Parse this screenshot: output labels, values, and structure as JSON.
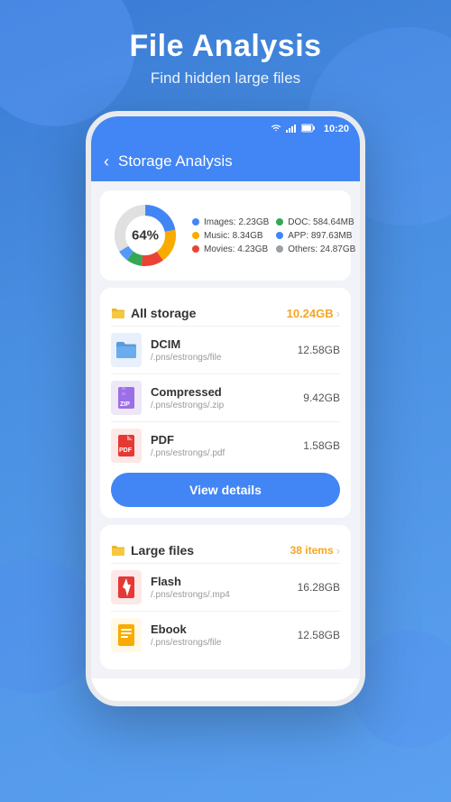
{
  "header": {
    "title": "File Analysis",
    "subtitle": "Find hidden large files"
  },
  "status_bar": {
    "time": "10:20"
  },
  "top_bar": {
    "title": "Storage Analysis",
    "back_label": "<"
  },
  "chart": {
    "percentage": "64%",
    "legend": [
      {
        "label": "Images:",
        "value": "2.23GB",
        "color": "#4285f4"
      },
      {
        "label": "DOC:",
        "value": "584.64MB",
        "color": "#34a853"
      },
      {
        "label": "Music:",
        "value": "8.34GB",
        "color": "#f9ab00"
      },
      {
        "label": "APP:",
        "value": "897.63MB",
        "color": "#4285f4"
      },
      {
        "label": "Movies:",
        "value": "4.23GB",
        "color": "#ea4335"
      },
      {
        "label": "Others:",
        "value": "24.87GB",
        "color": "#9aa0a6"
      }
    ]
  },
  "all_storage": {
    "title": "All storage",
    "value": "10.24GB",
    "items": [
      {
        "name": "DCIM",
        "path": "/.pns/estrongs/file",
        "size": "12.58GB",
        "icon_type": "folder"
      },
      {
        "name": "Compressed",
        "path": "/.pns/estrongs/.zip",
        "size": "9.42GB",
        "icon_type": "zip"
      },
      {
        "name": "PDF",
        "path": "/.pns/estrongs/.pdf",
        "size": "1.58GB",
        "icon_type": "pdf"
      }
    ],
    "btn_label": "View details"
  },
  "large_files": {
    "title": "Large files",
    "badge": "38 items",
    "items": [
      {
        "name": "Flash",
        "path": "/.pns/estrongs/.mp4",
        "size": "16.28GB",
        "icon_type": "flash"
      },
      {
        "name": "Ebook",
        "path": "/.pns/estrongs/file",
        "size": "12.58GB",
        "icon_type": "ebook"
      }
    ]
  },
  "donut": {
    "segments": [
      {
        "color": "#4285f4",
        "pct": 22
      },
      {
        "color": "#f9ab00",
        "pct": 18
      },
      {
        "color": "#ea4335",
        "pct": 12
      },
      {
        "color": "#34a853",
        "pct": 8
      },
      {
        "color": "#4285f4",
        "pct": 6
      },
      {
        "color": "#9aa0a6",
        "pct": 34
      }
    ]
  }
}
